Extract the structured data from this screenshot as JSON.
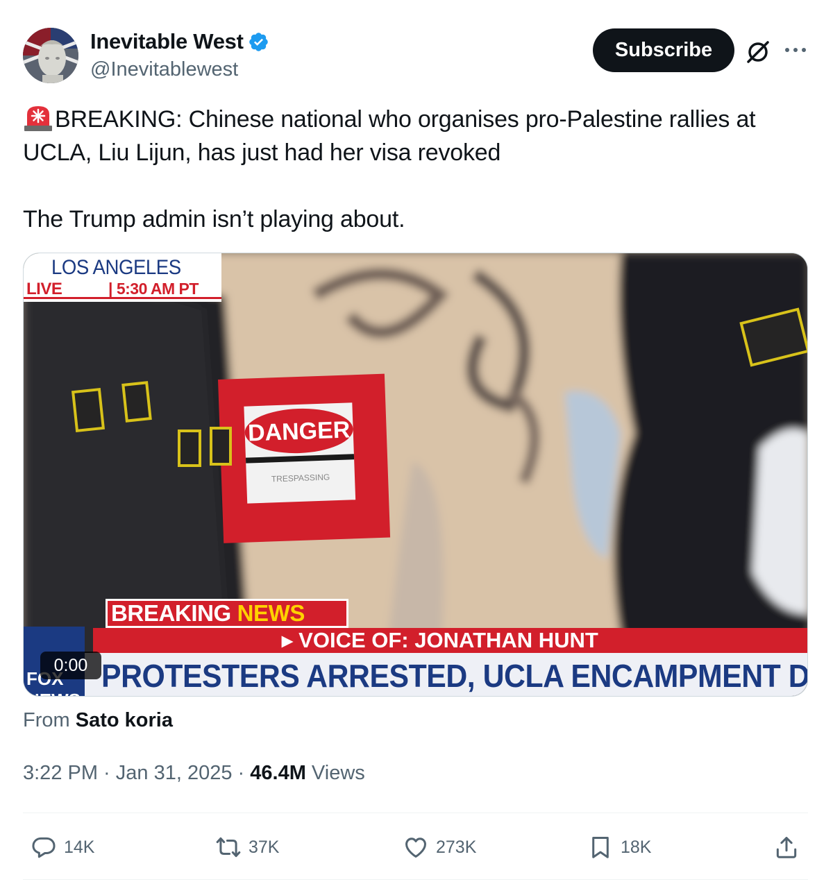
{
  "author": {
    "name": "Inevitable West",
    "handle": "@Inevitablewest",
    "verified_icon": "verified-badge-icon",
    "avatar_icon": "avatar-image"
  },
  "header": {
    "subscribe_label": "Subscribe",
    "grok_icon": "grok-icon",
    "more_icon": "more-options-icon"
  },
  "tweet": {
    "emoji": "siren-emoji",
    "text_line1": "BREAKING: Chinese national who organises pro-Palestine rallies at UCLA, Liu Lijun, has just had her visa revoked",
    "text_line2": "The Trump admin isn’t playing about."
  },
  "video": {
    "city": "LOS ANGELES",
    "live_label": "LIVE",
    "time_label": "| 5:30 AM PT",
    "danger_sign": "DANGER",
    "trespassing": "TRESPASSING",
    "breaking": "BREAKING",
    "news": "NEWS",
    "voice_of": "▸ VOICE OF: JONATHAN HUNT",
    "ticker": "PROTESTERS ARRESTED, UCLA ENCAMPMENT DISMANT",
    "channel_logo": "FOX NEWS",
    "timer": "0:00"
  },
  "attribution": {
    "from_label": "From",
    "from_name": "Sato koria"
  },
  "meta": {
    "time": "3:22 PM",
    "sep1": " · ",
    "date": "Jan 31, 2025",
    "sep2": " · ",
    "views_count": "46.4M",
    "views_label": " Views"
  },
  "actions": {
    "replies": "14K",
    "reposts": "37K",
    "likes": "273K",
    "bookmarks": "18K"
  },
  "colors": {
    "text": "#0f1419",
    "secondary": "#536471",
    "verified": "#1d9bf0",
    "fox_red": "#d21f2b",
    "fox_blue": "#1b3a82"
  }
}
